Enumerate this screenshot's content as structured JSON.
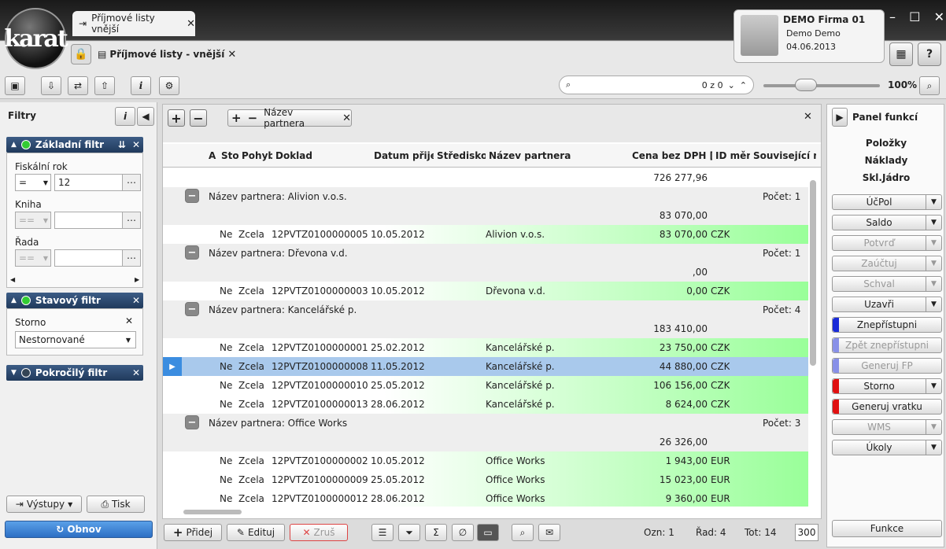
{
  "app": {
    "logo_text": "karat"
  },
  "tabs": {
    "tab1_label": "Příjmové listy vnější",
    "tab2_label": "Příjmové listy - vnější"
  },
  "user": {
    "company": "DEMO Firma 01",
    "name": "Demo Demo",
    "date": "04.06.2013"
  },
  "window": {
    "minimize": "–",
    "maximize": "☐",
    "close": "✕"
  },
  "toolbar": {
    "search_placeholder": "",
    "search_count": "0 z 0",
    "zoom": "100%"
  },
  "filters": {
    "title": "Filtry",
    "basic": {
      "title": "Základní filtr",
      "fiscal_label": "Fiskální rok",
      "fiscal_op": "=",
      "fiscal_value": "12",
      "book_label": "Kniha",
      "book_op": "==",
      "book_value": "",
      "series_label": "Řada",
      "series_op": "==",
      "series_value": ""
    },
    "status": {
      "title": "Stavový filtr",
      "storno_label": "Storno",
      "storno_value": "Nestornované"
    },
    "advanced": {
      "title": "Pokročilý filtr"
    },
    "outputs_label": "Výstupy",
    "print_label": "Tisk",
    "refresh_label": "Obnov"
  },
  "grid": {
    "group_chip": "Název partnera",
    "columns": [
      "A",
      "Sto",
      "Pohyby",
      "Doklad",
      "Datum přijetí",
      "Středisko",
      "Název partnera",
      "Cena bez DPH [MC",
      "ID měny",
      "Související na"
    ],
    "total": "726 277,96",
    "group_prefix": "Název partnera: ",
    "count_prefix": "Počet: ",
    "groups": [
      {
        "name": "Alivion v.o.s.",
        "count": "1",
        "sum": "83 070,00",
        "rows": [
          {
            "sto": "Ne",
            "pohyby": "Zcela",
            "doklad": "12PVTZ0100000005",
            "datum": "10.05.2012",
            "partner": "Alivion v.o.s.",
            "cena": "83 070,00",
            "mena": "CZK"
          }
        ]
      },
      {
        "name": "Dřevona v.d.",
        "count": "1",
        "sum": ",00",
        "rows": [
          {
            "sto": "Ne",
            "pohyby": "Zcela",
            "doklad": "12PVTZ0100000003",
            "datum": "10.05.2012",
            "partner": "Dřevona v.d.",
            "cena": "0,00",
            "mena": "CZK"
          }
        ]
      },
      {
        "name": "Kancelářské p.",
        "count": "4",
        "sum": "183 410,00",
        "rows": [
          {
            "sto": "Ne",
            "pohyby": "Zcela",
            "doklad": "12PVTZ0100000001",
            "datum": "25.02.2012",
            "partner": "Kancelářské p.",
            "cena": "23 750,00",
            "mena": "CZK"
          },
          {
            "sto": "Ne",
            "pohyby": "Zcela",
            "doklad": "12PVTZ0100000008",
            "datum": "11.05.2012",
            "partner": "Kancelářské p.",
            "cena": "44 880,00",
            "mena": "CZK"
          },
          {
            "sto": "Ne",
            "pohyby": "Zcela",
            "doklad": "12PVTZ0100000010",
            "datum": "25.05.2012",
            "partner": "Kancelářské p.",
            "cena": "106 156,00",
            "mena": "CZK"
          },
          {
            "sto": "Ne",
            "pohyby": "Zcela",
            "doklad": "12PVTZ0100000013",
            "datum": "28.06.2012",
            "partner": "Kancelářské p.",
            "cena": "8 624,00",
            "mena": "CZK"
          }
        ]
      },
      {
        "name": "Office Works",
        "count": "3",
        "sum": "26 326,00",
        "rows": [
          {
            "sto": "Ne",
            "pohyby": "Zcela",
            "doklad": "12PVTZ0100000002",
            "datum": "10.05.2012",
            "partner": "Office Works",
            "cena": "1 943,00",
            "mena": "EUR"
          },
          {
            "sto": "Ne",
            "pohyby": "Zcela",
            "doklad": "12PVTZ0100000009",
            "datum": "25.05.2012",
            "partner": "Office Works",
            "cena": "15 023,00",
            "mena": "EUR"
          },
          {
            "sto": "Ne",
            "pohyby": "Zcela",
            "doklad": "12PVTZ0100000012",
            "datum": "28.06.2012",
            "partner": "Office Works",
            "cena": "9 360,00",
            "mena": "EUR"
          }
        ]
      }
    ]
  },
  "bottom": {
    "add": "Přidej",
    "edit": "Edituj",
    "cancel": "Zruš",
    "ozn": "Ozn: 1",
    "rad": "Řad: 4",
    "tot": "Tot: 14",
    "page_size": "300"
  },
  "functions": {
    "title": "Panel funkcí",
    "links": [
      "Položky",
      "Náklady",
      "Skl.Jádro"
    ],
    "buttons": [
      {
        "label": "ÚčPol",
        "dropdown": true,
        "disabled": false,
        "mark": ""
      },
      {
        "label": "Saldo",
        "dropdown": true,
        "disabled": false,
        "mark": ""
      },
      {
        "label": "Potvrď",
        "dropdown": true,
        "disabled": true,
        "mark": ""
      },
      {
        "label": "Zaúčtuj",
        "dropdown": true,
        "disabled": true,
        "mark": ""
      },
      {
        "label": "Schval",
        "dropdown": true,
        "disabled": true,
        "mark": ""
      },
      {
        "label": "Uzavři",
        "dropdown": true,
        "disabled": false,
        "mark": ""
      },
      {
        "label": "Znepřístupni",
        "dropdown": false,
        "disabled": false,
        "mark": "#1a2bd8"
      },
      {
        "label": "Zpět znepřístupni",
        "dropdown": false,
        "disabled": true,
        "mark": "#8890e8"
      },
      {
        "label": "Generuj FP",
        "dropdown": false,
        "disabled": true,
        "mark": "#8890e8"
      },
      {
        "label": "Storno",
        "dropdown": true,
        "disabled": false,
        "mark": "#e01010"
      },
      {
        "label": "Generuj vratku",
        "dropdown": false,
        "disabled": false,
        "mark": "#e01010"
      },
      {
        "label": "WMS",
        "dropdown": true,
        "disabled": true,
        "mark": ""
      },
      {
        "label": "Úkoly",
        "dropdown": true,
        "disabled": false,
        "mark": ""
      }
    ],
    "bottom_button": "Funkce"
  }
}
